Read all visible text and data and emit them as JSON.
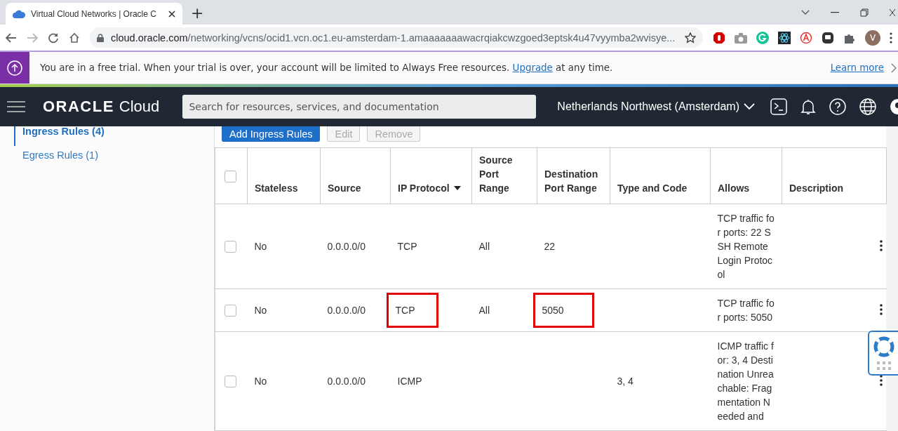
{
  "browser": {
    "tab_title": "Virtual Cloud Networks | Oracle C",
    "new_tab": "+",
    "url_host": "cloud.oracle.com",
    "url_path": "/networking/vcns/ocid1.vcn.oc1.eu-amsterdam-1.amaaaaaaawacrqiakcwzgoed3eptsk4u47vyymba2wvisye...",
    "avatar": "V"
  },
  "trial_banner": {
    "text_before": "You are in a free trial. When your trial is over, your account will be limited to Always Free resources. ",
    "link": "Upgrade",
    "text_after": " at any time.",
    "learn_more": "Learn more"
  },
  "header": {
    "logo_brand": "ORACLE",
    "logo_product": "Cloud",
    "search_placeholder": "Search for resources, services, and documentation",
    "region": "Netherlands Northwest (Amsterdam)"
  },
  "sidebar": {
    "items": [
      {
        "label": "Ingress Rules (4)",
        "selected": true
      },
      {
        "label": "Egress Rules (1)",
        "selected": false
      }
    ]
  },
  "toolbar": {
    "buttons": [
      {
        "label": "Add Ingress Rules",
        "kind": "primary",
        "disabled": false
      },
      {
        "label": "Edit",
        "kind": "secondary",
        "disabled": true
      },
      {
        "label": "Remove",
        "kind": "secondary",
        "disabled": true
      }
    ]
  },
  "table": {
    "select_all_checked": false,
    "columns": [
      {
        "label": "Stateless",
        "sorted": false
      },
      {
        "label": "Source",
        "sorted": false
      },
      {
        "label": "IP Protocol",
        "sorted": true
      },
      {
        "label": "Source Port Range",
        "sorted": false
      },
      {
        "label": "Destination Port Range",
        "sorted": false
      },
      {
        "label": "Type and Code",
        "sorted": false
      },
      {
        "label": "Allows",
        "sorted": false
      },
      {
        "label": "Description",
        "sorted": false
      }
    ],
    "rows": [
      {
        "checked": false,
        "stateless": "No",
        "source": "0.0.0.0/0",
        "ip_protocol": "TCP",
        "source_port_range": "All",
        "destination_port_range": "22",
        "allows": "TCP traffic for ports: 22 SSH Remote Login Protocol",
        "protocol_marked": false,
        "destination_marked": false
      },
      {
        "checked": false,
        "stateless": "No",
        "source": "0.0.0.0/0",
        "ip_protocol": "TCP",
        "source_port_range": "All",
        "destination_port_range": "5050",
        "allows": "TCP traffic for ports: 5050",
        "protocol_marked": true,
        "destination_marked": true
      },
      {
        "checked": false,
        "stateless": "No",
        "source": "0.0.0.0/0",
        "ip_protocol": "ICMP",
        "type_and_code": "3, 4",
        "allows": "ICMP traffic for: 3, 4 Destination Unreachable: Fragmentation Needed and",
        "protocol_marked": false
      }
    ]
  }
}
